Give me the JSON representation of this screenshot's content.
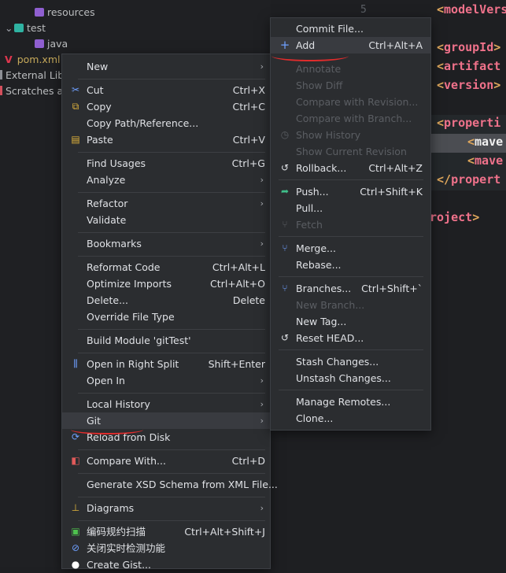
{
  "colors": {
    "accent": "#3574f0",
    "annotation": "#e02c2c",
    "menu_bg": "#2b2d30",
    "selected_bg": "#393b40"
  },
  "tree": {
    "rows": [
      {
        "label": "resources",
        "icon": "resources-folder-icon"
      },
      {
        "label": "test",
        "icon": "test-folder-icon"
      },
      {
        "label": "java",
        "icon": "java-folder-icon"
      },
      {
        "label": "pom.xml",
        "icon": "maven-icon"
      },
      {
        "label": "External Libr",
        "icon": "library-icon"
      },
      {
        "label": "Scratches ar",
        "icon": "scratches-icon"
      }
    ]
  },
  "editor": {
    "line_number": "5",
    "lines": [
      {
        "bracket": "<",
        "name": "modelVers"
      },
      {
        "bracket": "<",
        "name": "groupId",
        "close": ">"
      },
      {
        "bracket": "<",
        "name": "artifact"
      },
      {
        "bracket": "<",
        "name": "version",
        "close": ">"
      },
      {
        "bracket": "<",
        "name": "properti"
      },
      {
        "bracket": "<",
        "name": "mave"
      },
      {
        "bracket": "<",
        "name": "mave"
      },
      {
        "bracket": "</",
        "name": "propert"
      },
      {
        "bracket": "",
        "name": "roject",
        "close": ">"
      }
    ]
  },
  "menu": {
    "items": [
      {
        "label": "New",
        "arrow": "›"
      },
      {
        "label": "Cut",
        "shortcut": "Ctrl+X",
        "icon": "scissors-icon"
      },
      {
        "label": "Copy",
        "shortcut": "Ctrl+C",
        "icon": "copy-icon"
      },
      {
        "label": "Copy Path/Reference..."
      },
      {
        "label": "Paste",
        "shortcut": "Ctrl+V",
        "icon": "clipboard-icon"
      },
      {
        "label": "Find Usages",
        "shortcut": "Ctrl+G"
      },
      {
        "label": "Analyze",
        "arrow": "›"
      },
      {
        "label": "Refactor",
        "arrow": "›"
      },
      {
        "label": "Validate"
      },
      {
        "label": "Bookmarks",
        "arrow": "›"
      },
      {
        "label": "Reformat Code",
        "shortcut": "Ctrl+Alt+L"
      },
      {
        "label": "Optimize Imports",
        "shortcut": "Ctrl+Alt+O"
      },
      {
        "label": "Delete...",
        "shortcut": "Delete"
      },
      {
        "label": "Override File Type"
      },
      {
        "label": "Build Module 'gitTest'"
      },
      {
        "label": "Open in Right Split",
        "shortcut": "Shift+Enter",
        "icon": "split-icon"
      },
      {
        "label": "Open In",
        "arrow": "›"
      },
      {
        "label": "Local History",
        "arrow": "›"
      },
      {
        "label": "Git",
        "arrow": "›"
      },
      {
        "label": "Reload from Disk",
        "icon": "reload-icon"
      },
      {
        "label": "Compare With...",
        "shortcut": "Ctrl+D",
        "icon": "compare-icon"
      },
      {
        "label": "Generate XSD Schema from XML File..."
      },
      {
        "label": "Diagrams",
        "arrow": "›",
        "icon": "diagram-icon"
      },
      {
        "label": "编码规约扫描",
        "shortcut": "Ctrl+Alt+Shift+J",
        "icon": "scan-icon"
      },
      {
        "label": "关闭实时检测功能",
        "icon": "disable-icon"
      },
      {
        "label": "Create Gist...",
        "icon": "github-icon"
      }
    ]
  },
  "git_submenu": {
    "items": [
      {
        "label": "Commit File..."
      },
      {
        "label": "Add",
        "shortcut": "Ctrl+Alt+A",
        "icon": "plus-icon"
      },
      {
        "label": "Annotate",
        "disabled": true
      },
      {
        "label": "Show Diff",
        "disabled": true
      },
      {
        "label": "Compare with Revision...",
        "disabled": true
      },
      {
        "label": "Compare with Branch...",
        "disabled": true
      },
      {
        "label": "Show History",
        "disabled": true,
        "icon": "history-icon"
      },
      {
        "label": "Show Current Revision",
        "disabled": true
      },
      {
        "label": "Rollback...",
        "shortcut": "Ctrl+Alt+Z",
        "icon": "rollback-icon"
      },
      {
        "label": "Push...",
        "shortcut": "Ctrl+Shift+K",
        "icon": "push-icon"
      },
      {
        "label": "Pull..."
      },
      {
        "label": "Fetch",
        "disabled": true,
        "icon": "fetch-icon"
      },
      {
        "label": "Merge...",
        "icon": "merge-icon"
      },
      {
        "label": "Rebase..."
      },
      {
        "label": "Branches...",
        "shortcut": "Ctrl+Shift+`",
        "icon": "branch-icon"
      },
      {
        "label": "New Branch...",
        "disabled": true
      },
      {
        "label": "New Tag..."
      },
      {
        "label": "Reset HEAD...",
        "icon": "reset-icon"
      },
      {
        "label": "Stash Changes..."
      },
      {
        "label": "Unstash Changes..."
      },
      {
        "label": "Manage Remotes..."
      },
      {
        "label": "Clone..."
      }
    ]
  }
}
